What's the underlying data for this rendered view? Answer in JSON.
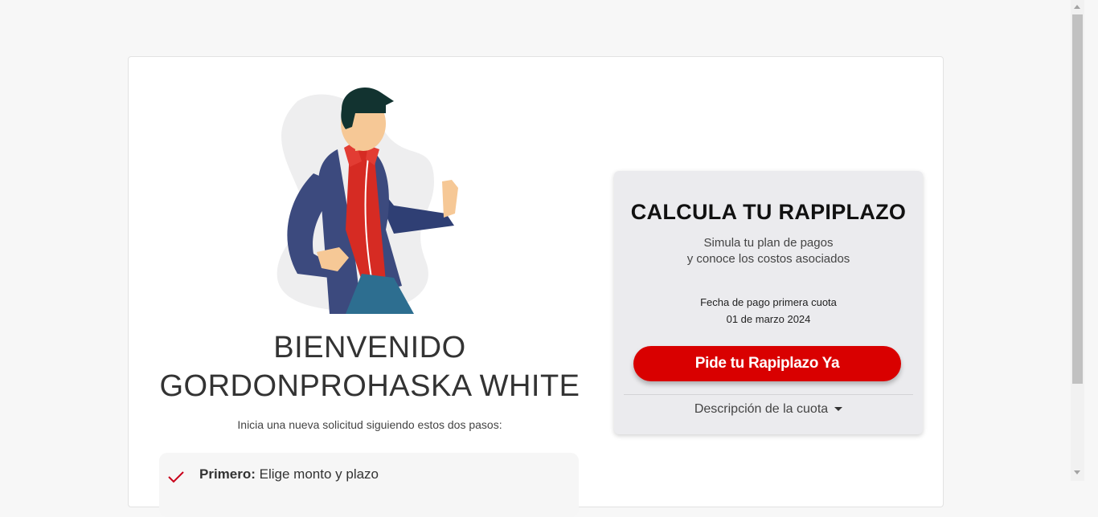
{
  "welcome": {
    "line1": "BIENVENIDO",
    "line2": "GORDONPROHASKA WHITE",
    "intro": "Inicia una nueva solicitud siguiendo estos dos pasos:"
  },
  "steps": [
    {
      "label": "Primero:",
      "text": " Elige monto y plazo"
    }
  ],
  "calculator": {
    "title": "CALCULA TU RAPIPLAZO",
    "subtitle_line1": "Simula tu plan de pagos",
    "subtitle_line2": "y conoce los costos asociados",
    "first_payment_label": "Fecha de pago primera cuota",
    "first_payment_date": "01 de marzo 2024",
    "cta_label": "Pide tu Rapiplazo Ya",
    "description_toggle": "Descripción de la cuota"
  },
  "colors": {
    "brand_red": "#d90000",
    "card_background": "#ebebee",
    "page_background": "#f7f7f7"
  },
  "icons": {
    "step_check": "check-icon",
    "description_toggle": "caret-down-icon"
  }
}
